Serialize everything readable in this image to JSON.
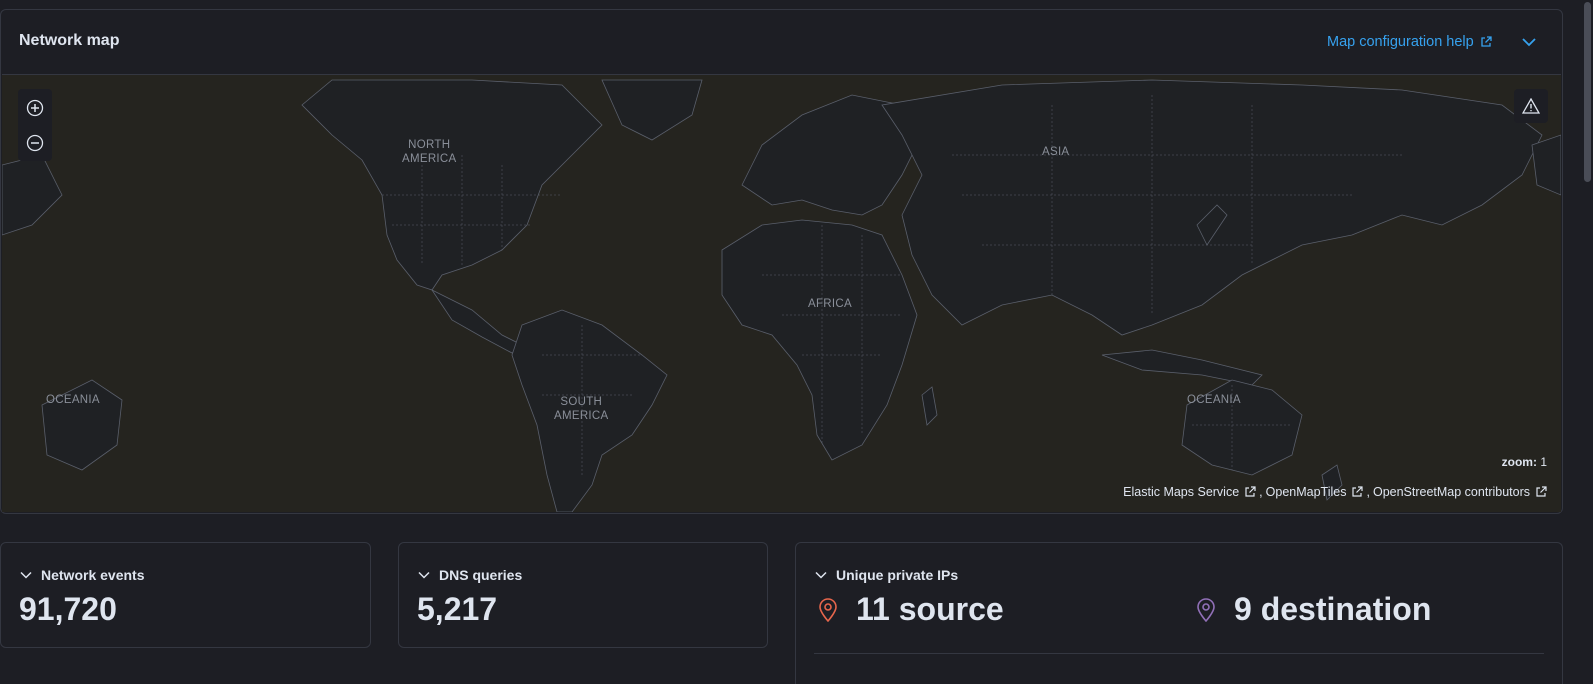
{
  "panel": {
    "title": "Network map",
    "help_link": "Map configuration help"
  },
  "map": {
    "continents": {
      "north_america_1": "NORTH",
      "north_america_2": "AMERICA",
      "south_america_1": "SOUTH",
      "south_america_2": "AMERICA",
      "africa": "AFRICA",
      "asia": "ASIA",
      "oceania_left": "OCEANIA",
      "oceania_right": "OCEANIA"
    },
    "zoom_label": "zoom:",
    "zoom_value": "1",
    "attribution": {
      "ems": "Elastic Maps Service",
      "omt": "OpenMapTiles",
      "osm": "OpenStreetMap contributors",
      "sep": ","
    }
  },
  "stats": {
    "network_events": {
      "label": "Network events",
      "value": "91,720"
    },
    "dns_queries": {
      "label": "DNS queries",
      "value": "5,217"
    },
    "unique_ips": {
      "label": "Unique private IPs",
      "source": "11 source",
      "destination": "9 destination"
    }
  },
  "colors": {
    "accent": "#36a2ef",
    "source_icon": "#e7664c",
    "destination_icon": "#9170b8"
  },
  "icons": {
    "external": "external-link-icon",
    "chevron": "chevron-down-icon",
    "zoom_in": "plus-in-circle-icon",
    "zoom_out": "minus-in-circle-icon",
    "warning": "warning-icon",
    "pin": "map-pin-icon"
  }
}
